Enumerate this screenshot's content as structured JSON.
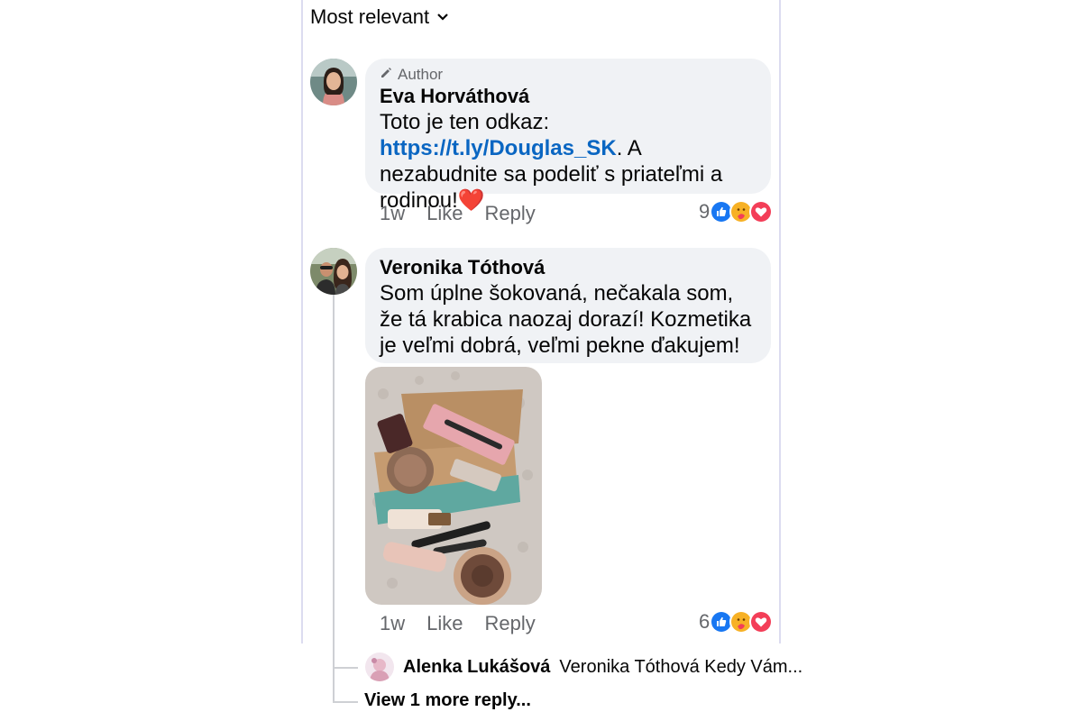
{
  "sort": {
    "label": "Most relevant"
  },
  "comments": [
    {
      "author_tag": "Author",
      "name": "Eva Horváthová",
      "text_before": "Toto je ten odkaz: ",
      "link": "https://t.ly/Douglas_SK",
      "text_after": ". A nezabudnite sa podeliť s priateľmi a rodinou!❤️",
      "time": "1w",
      "like_label": "Like",
      "reply_label": "Reply",
      "reaction_count": "9"
    },
    {
      "name": "Veronika Tóthová",
      "text": "Som úplne šokovaná, nečakala som, že tá krabica naozaj dorazí! Kozmetika je veľmi dobrá, veľmi pekne ďakujem!",
      "time": "1w",
      "like_label": "Like",
      "reply_label": "Reply",
      "reaction_count": "6"
    }
  ],
  "reply_preview": {
    "name": "Alenka Lukášová",
    "text": "Veronika Tóthová Kedy Vám..."
  },
  "view_more": "View 1 more reply...",
  "icons": [
    "chevron-down-icon",
    "pencil-icon",
    "like-icon",
    "care-icon",
    "love-icon"
  ],
  "colors": {
    "link": "#0a66c2",
    "bubble": "#f0f2f5",
    "muted": "#65676b",
    "like": "#1877f2",
    "love": "#f33e58"
  }
}
